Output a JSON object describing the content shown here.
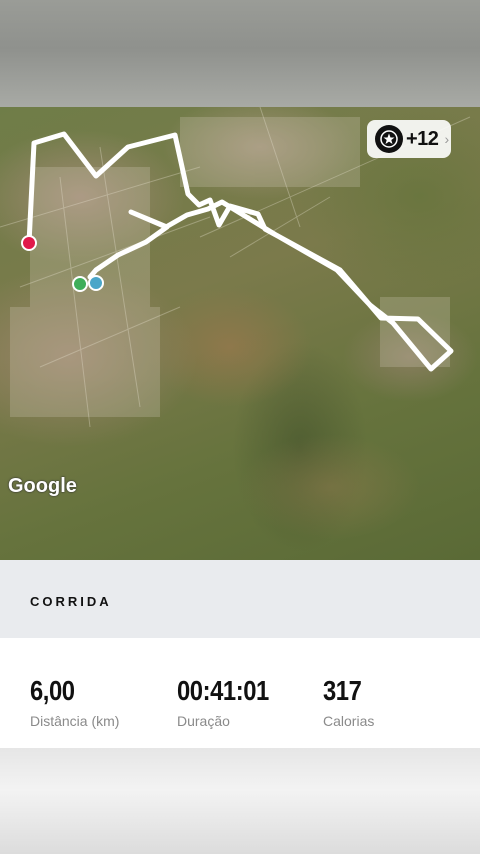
{
  "map": {
    "attribution": "Google",
    "badge": {
      "count": "+12",
      "icon": "star-medal-icon"
    },
    "route_color": "#ffffff",
    "markers": {
      "end_color": "#e0194a",
      "start_color": "#3fae5a",
      "current_color": "#4aa6c9"
    }
  },
  "activity": {
    "title": "CORRIDA",
    "stats": [
      {
        "value": "6,00",
        "label": "Distância (km)"
      },
      {
        "value": "00:41:01",
        "label": "Duração"
      },
      {
        "value": "317",
        "label": "Calorias"
      }
    ]
  }
}
